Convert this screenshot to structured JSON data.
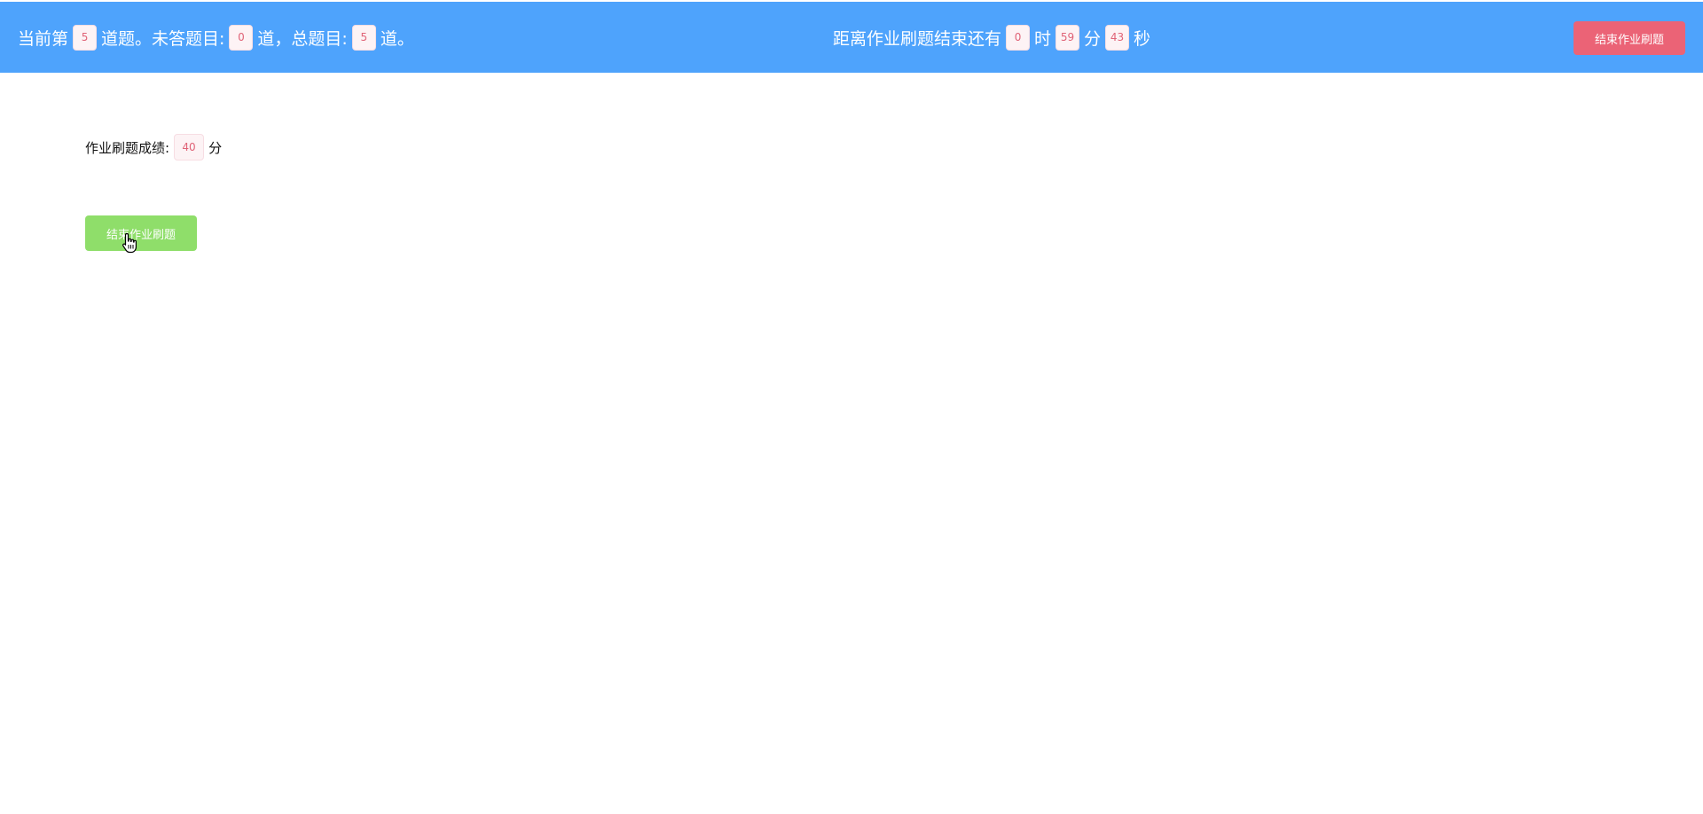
{
  "header": {
    "progress": {
      "prefix": "当前第",
      "current": "5",
      "mid1": "道题。未答题目:",
      "unanswered": "0",
      "mid2": "道，总题目:",
      "total": "5",
      "suffix": "道。"
    },
    "timer": {
      "prefix": "距离作业刷题结束还有",
      "hours": "0",
      "hours_unit": "时",
      "minutes": "59",
      "minutes_unit": "分",
      "seconds": "43",
      "seconds_unit": "秒"
    },
    "end_button_label": "结束作业刷题"
  },
  "main": {
    "score_label": "作业刷题成绩:",
    "score_value": "40",
    "score_unit": "分",
    "end_button_label": "结束作业刷题"
  },
  "colors": {
    "header_bg": "#4ea3fc",
    "danger_button": "#eb6376",
    "success_button": "#8fde6a",
    "number_text": "#e06377"
  }
}
